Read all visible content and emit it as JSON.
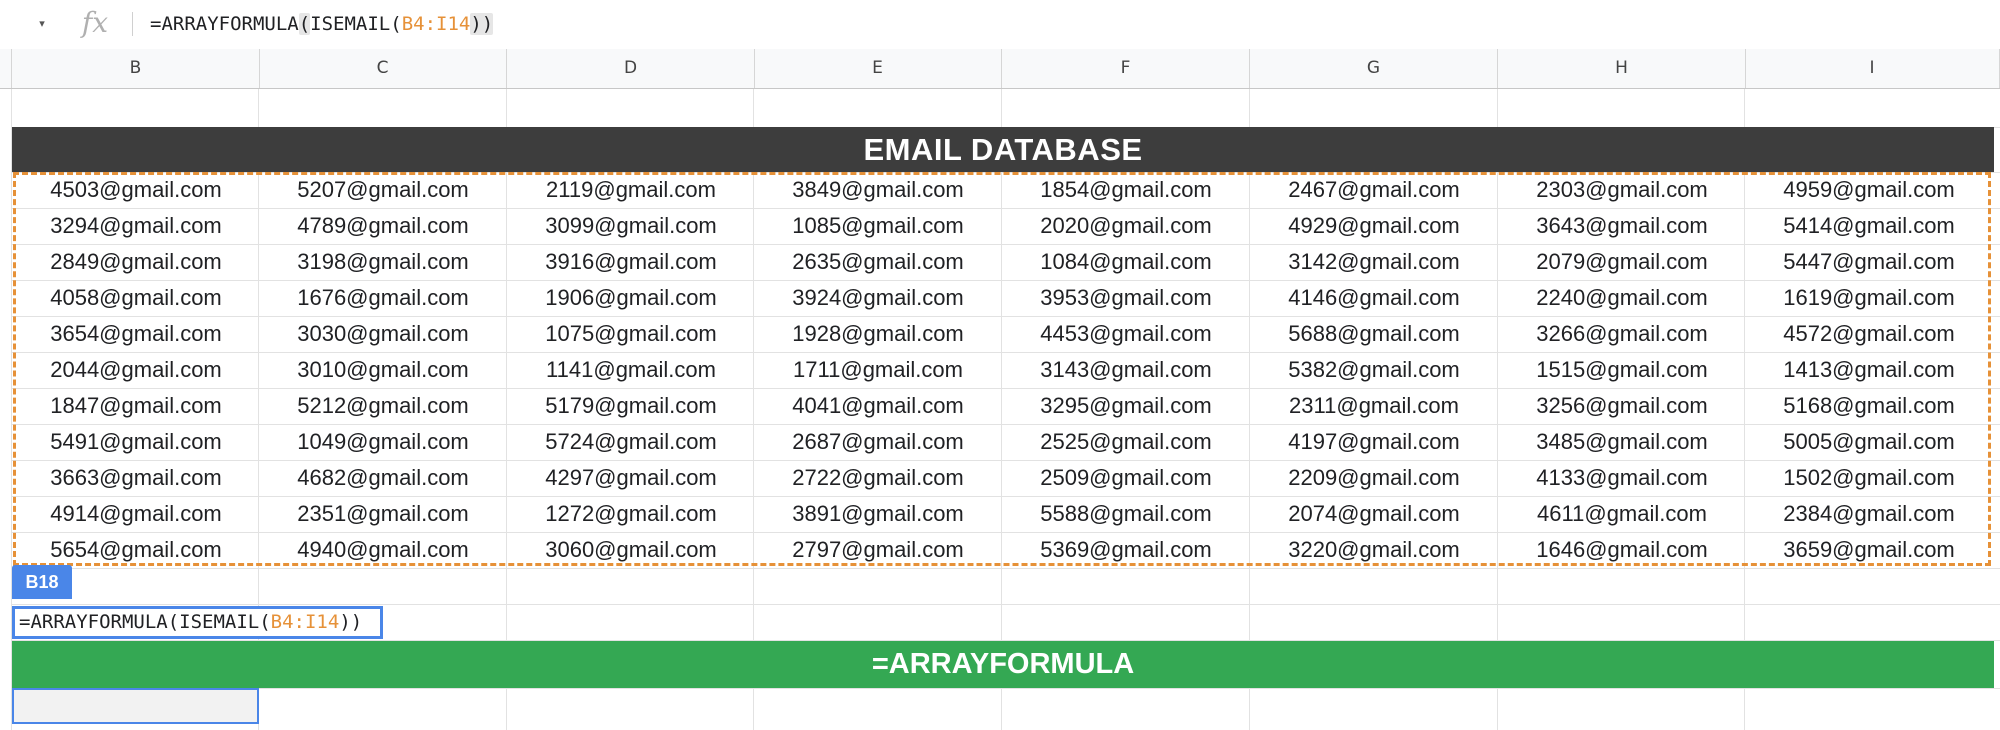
{
  "formula_bar": {
    "namebox_caret": "▾",
    "fx_label": "fx",
    "formula_prefix": "=ARRAYFORMULA",
    "formula_open": "(",
    "formula_mid": "ISEMAIL(",
    "formula_ref": "B4:I14",
    "formula_close": "))"
  },
  "columns": [
    "B",
    "C",
    "D",
    "E",
    "F",
    "G",
    "H",
    "I"
  ],
  "sheet": {
    "title": "EMAIL DATABASE",
    "rows": [
      [
        "4503@gmail.com",
        "5207@gmail.com",
        "2119@gmail.com",
        "3849@gmail.com",
        "1854@gmail.com",
        "2467@gmail.com",
        "2303@gmail.com",
        "4959@gmail.com"
      ],
      [
        "3294@gmail.com",
        "4789@gmail.com",
        "3099@gmail.com",
        "1085@gmail.com",
        "2020@gmail.com",
        "4929@gmail.com",
        "3643@gmail.com",
        "5414@gmail.com"
      ],
      [
        "2849@gmail.com",
        "3198@gmail.com",
        "3916@gmail.com",
        "2635@gmail.com",
        "1084@gmail.com",
        "3142@gmail.com",
        "2079@gmail.com",
        "5447@gmail.com"
      ],
      [
        "4058@gmail.com",
        "1676@gmail.com",
        "1906@gmail.com",
        "3924@gmail.com",
        "3953@gmail.com",
        "4146@gmail.com",
        "2240@gmail.com",
        "1619@gmail.com"
      ],
      [
        "3654@gmail.com",
        "3030@gmail.com",
        "1075@gmail.com",
        "1928@gmail.com",
        "4453@gmail.com",
        "5688@gmail.com",
        "3266@gmail.com",
        "4572@gmail.com"
      ],
      [
        "2044@gmail.com",
        "3010@gmail.com",
        "1141@gmail.com",
        "1711@gmail.com",
        "3143@gmail.com",
        "5382@gmail.com",
        "1515@gmail.com",
        "1413@gmail.com"
      ],
      [
        "1847@gmail.com",
        "5212@gmail.com",
        "5179@gmail.com",
        "4041@gmail.com",
        "3295@gmail.com",
        "2311@gmail.com",
        "3256@gmail.com",
        "5168@gmail.com"
      ],
      [
        "5491@gmail.com",
        "1049@gmail.com",
        "5724@gmail.com",
        "2687@gmail.com",
        "2525@gmail.com",
        "4197@gmail.com",
        "3485@gmail.com",
        "5005@gmail.com"
      ],
      [
        "3663@gmail.com",
        "4682@gmail.com",
        "4297@gmail.com",
        "2722@gmail.com",
        "2509@gmail.com",
        "2209@gmail.com",
        "4133@gmail.com",
        "1502@gmail.com"
      ],
      [
        "4914@gmail.com",
        "2351@gmail.com",
        "1272@gmail.com",
        "3891@gmail.com",
        "5588@gmail.com",
        "2074@gmail.com",
        "4611@gmail.com",
        "2384@gmail.com"
      ],
      [
        "5654@gmail.com",
        "4940@gmail.com",
        "3060@gmail.com",
        "2797@gmail.com",
        "5369@gmail.com",
        "3220@gmail.com",
        "1646@gmail.com",
        "3659@gmail.com"
      ]
    ],
    "cell_tag": "B18",
    "edit_prefix": "=ARRAYFORMULA(ISEMAIL(",
    "edit_ref": "B4:I14",
    "edit_suffix": "))",
    "green_banner": "=ARRAYFORMULA"
  },
  "colors": {
    "title_band": "#3d3d3d",
    "green_band": "#34a853",
    "reference": "#e69138",
    "selection": "#4a86e8"
  }
}
